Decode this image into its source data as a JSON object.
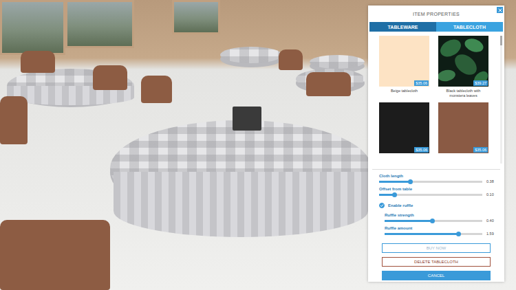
{
  "panel": {
    "title": "ITEM PROPERTIES"
  },
  "tabs": [
    {
      "label": "TABLEWARE",
      "selected": false
    },
    {
      "label": "TABLECLOTH",
      "selected": true
    }
  ],
  "items": [
    {
      "name": "Beige tablecloth",
      "price": "$35.06",
      "color": "#fde3c4",
      "kind": "plain"
    },
    {
      "name": "Black tablecloth with monstera leaves",
      "price": "$39.27",
      "color": "#0e1d15",
      "kind": "leaves"
    },
    {
      "name": "",
      "price": "$35.06",
      "color": "#1c1c1c",
      "kind": "plain"
    },
    {
      "name": "",
      "price": "$35.06",
      "color": "#8a5a44",
      "kind": "plain"
    }
  ],
  "sliders": [
    {
      "label": "Cloth length",
      "level": 0.3,
      "reading": "0.38"
    },
    {
      "label": "Offset from table",
      "level": 0.15,
      "reading": "0.10"
    }
  ],
  "ruffle": {
    "label": "Enable ruffle",
    "checked": true,
    "sliders": [
      {
        "label": "Ruffle strength",
        "level": 0.49,
        "reading": "0.40"
      },
      {
        "label": "Ruffle amount",
        "level": 0.76,
        "reading": "1.59"
      }
    ]
  },
  "buttons": [
    {
      "label": "BUY NOW",
      "kind": "outline",
      "disabled": true
    },
    {
      "label": "DELETE TABLECLOTH",
      "kind": "danger",
      "disabled": false
    },
    {
      "label": "CANCEL",
      "kind": "primary",
      "disabled": false
    }
  ]
}
